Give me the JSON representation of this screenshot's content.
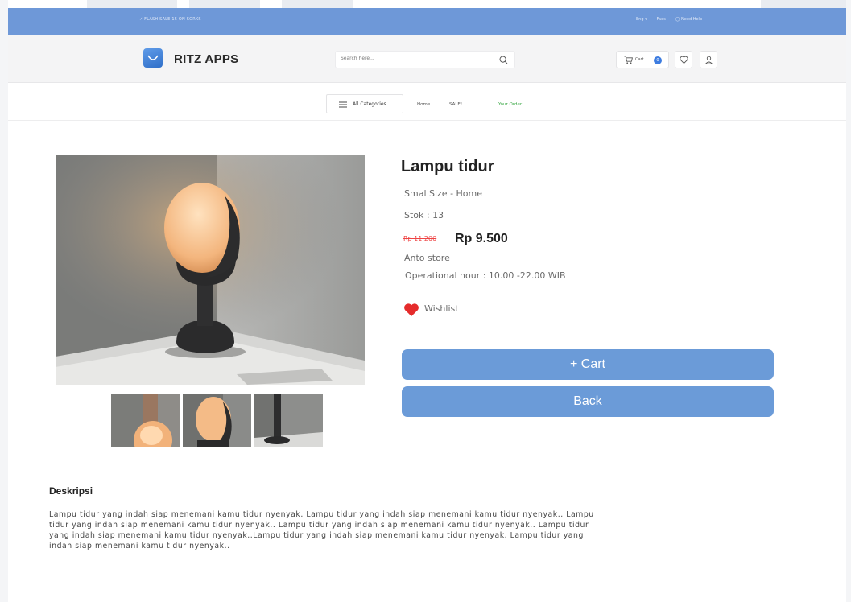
{
  "promo": {
    "left_text": "✓ FLASH SALE 15 ON SORKS",
    "right_links": [
      "Eng ▾",
      "Faqs",
      "◯ Need Help"
    ]
  },
  "header": {
    "brand": "RITZ APPS",
    "search_placeholder": "Search here...",
    "cart_label": "Cart",
    "cart_count": "0"
  },
  "nav": {
    "all_categories": "All Categories",
    "links": [
      "Home",
      "SALE!"
    ],
    "separator": "|",
    "order_link": "Your Order"
  },
  "product": {
    "title": "Lampu tidur",
    "subtitle": "Smal Size - Home",
    "stock": "Stok : 13",
    "price_old": "Rp 11.200",
    "price_new": "Rp 9.500",
    "store": "Anto store",
    "hours": "Operational hour : 10.00 -22.00 WIB",
    "wishlist": "Wishlist",
    "cart_button": "+ Cart",
    "back_button": "Back"
  },
  "description": {
    "title": "Deskripsi",
    "body": "Lampu tidur yang indah siap menemani kamu tidur nyenyak. Lampu tidur yang indah siap menemani kamu tidur nyenyak.. Lampu tidur yang indah siap menemani kamu tidur nyenyak.. Lampu tidur yang indah siap menemani kamu tidur nyenyak.. Lampu tidur yang indah siap menemani kamu tidur nyenyak..Lampu tidur yang indah siap menemani kamu tidur nyenyak. Lampu tidur yang indah siap menemani kamu tidur nyenyak.."
  },
  "colors": {
    "accent": "#6b9bd8",
    "promo_bar": "#6e98d8",
    "price_old": "#ee4444",
    "order_link": "#3aa845",
    "heart": "#e52b2b"
  }
}
